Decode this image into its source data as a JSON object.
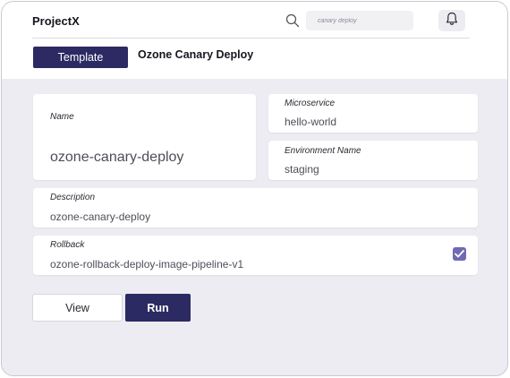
{
  "app": {
    "title": "ProjectX"
  },
  "search": {
    "placeholder": "canary deploy"
  },
  "header": {
    "template_label": "Template",
    "page_title": "Ozone Canary Deploy"
  },
  "form": {
    "name": {
      "label": "Name",
      "value": "ozone-canary-deploy"
    },
    "microservice": {
      "label": "Microservice",
      "value": "hello-world"
    },
    "environment": {
      "label": "Environment Name",
      "value": "staging"
    },
    "description": {
      "label": "Description",
      "value": "ozone-canary-deploy"
    },
    "rollback": {
      "label": "Rollback",
      "value": "ozone-rollback-deploy-image-pipeline-v1",
      "checked": true
    }
  },
  "actions": {
    "view_label": "View",
    "run_label": "Run"
  },
  "colors": {
    "primary": "#2c2a63",
    "checkbox": "#6f6ab4",
    "background": "#ececf2"
  },
  "icons": {
    "search": "search-icon",
    "notifications": "bell-icon",
    "check": "checkmark-icon"
  }
}
